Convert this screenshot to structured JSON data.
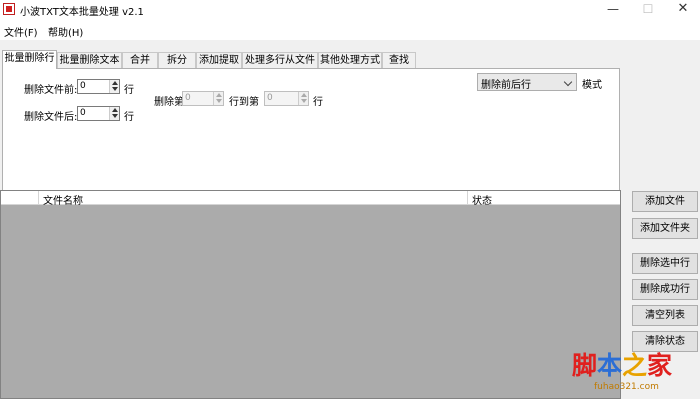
{
  "window": {
    "title": "小波TXT文本批量处理 v2.1",
    "min_glyph": "—",
    "max_glyph": "☐",
    "close_glyph": "✕"
  },
  "menu": [
    {
      "label": "文件(F)"
    },
    {
      "label": "帮助(H)"
    }
  ],
  "tabs": [
    {
      "label": "批量删除行",
      "active": true
    },
    {
      "label": "批量删除文本"
    },
    {
      "label": "合并"
    },
    {
      "label": "拆分"
    },
    {
      "label": "添加提取"
    },
    {
      "label": "处理多行从文件"
    },
    {
      "label": "其他处理方式"
    },
    {
      "label": "查找"
    }
  ],
  "panel": {
    "delete_before_label": "删除文件前:",
    "delete_before_value": "0",
    "delete_after_label": "删除文件后:",
    "delete_after_value": "0",
    "row_unit": "行",
    "delete_from_label": "删除第",
    "delete_from_value": "0",
    "to_row_label": "行到第",
    "to_row_value": "0",
    "mode_selected": "删除前后行",
    "mode_label": "模式"
  },
  "file_list": {
    "columns": [
      "",
      "文件名称",
      "状态"
    ],
    "rows": []
  },
  "side_buttons": {
    "add_file": "添加文件",
    "add_folder": "添加文件夹",
    "delete_selected": "删除选中行",
    "delete_success": "删除成功行",
    "clear_list": "清空列表",
    "clear_status": "清除状态"
  },
  "watermark": {
    "main": "脚本之家",
    "sub": "fuhao321.com",
    "colors": [
      "#e0201e",
      "#2c6ed5",
      "#e8a200",
      "#e0201e"
    ]
  },
  "colors": {
    "list_background": "#ababab",
    "window_background": "#f0f0f0"
  }
}
